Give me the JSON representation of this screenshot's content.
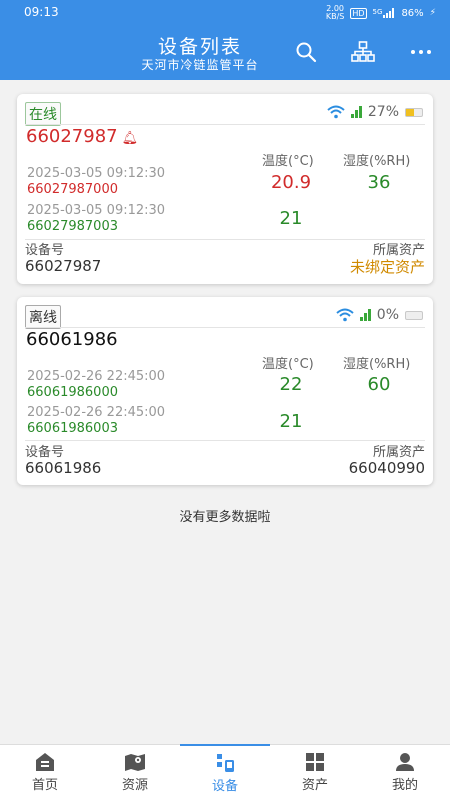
{
  "status_bar": {
    "time": "09:13",
    "speed_value": "2.00",
    "speed_unit": "KB/S",
    "net_tag": "HD",
    "signal_label": "5G",
    "battery": "86%"
  },
  "header": {
    "title": "设备列表",
    "subtitle": "天河市冷链监管平台"
  },
  "devices": [
    {
      "status": "在线",
      "signal_percent": "27%",
      "battery_level": 0.27,
      "name": "66027987",
      "temp_header": "温度(°C)",
      "hum_header": "湿度(%RH)",
      "sensors": [
        {
          "time": "2025-03-05 09:12:30",
          "id": "66027987000",
          "temp": "20.9",
          "humidity": "36"
        },
        {
          "time": "2025-03-05 09:12:30",
          "id": "66027987003",
          "temp": "21",
          "humidity": ""
        }
      ],
      "device_no_label": "设备号",
      "device_no": "66027987",
      "asset_label": "所属资产",
      "asset": "未绑定资产"
    },
    {
      "status": "离线",
      "signal_percent": "0%",
      "battery_level": 0,
      "name": "66061986",
      "temp_header": "温度(°C)",
      "hum_header": "湿度(%RH)",
      "sensors": [
        {
          "time": "2025-02-26 22:45:00",
          "id": "66061986000",
          "temp": "22",
          "humidity": "60"
        },
        {
          "time": "2025-02-26 22:45:00",
          "id": "66061986003",
          "temp": "21",
          "humidity": ""
        }
      ],
      "device_no_label": "设备号",
      "device_no": "66061986",
      "asset_label": "所属资产",
      "asset": "66040990"
    }
  ],
  "no_more": "没有更多数据啦",
  "nav": [
    {
      "label": "首页",
      "icon": "home-icon"
    },
    {
      "label": "资源",
      "icon": "map-icon"
    },
    {
      "label": "设备",
      "icon": "device-icon"
    },
    {
      "label": "资产",
      "icon": "grid-icon"
    },
    {
      "label": "我的",
      "icon": "user-icon"
    }
  ],
  "colors": {
    "primary": "#3a8ee6",
    "alert_red": "#d12b2b",
    "ok_green": "#2a8a2a",
    "warn_orange": "#d08a00"
  }
}
